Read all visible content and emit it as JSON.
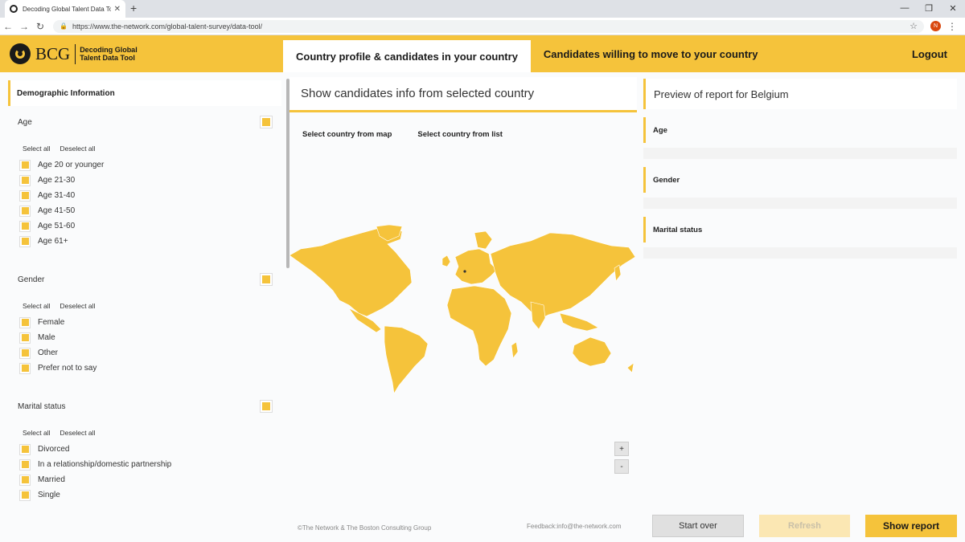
{
  "browser": {
    "tab_title": "Decoding Global Talent Data Too",
    "url": "https://www.the-network.com/global-talent-survey/data-tool/",
    "profile_initial": "N"
  },
  "header": {
    "logo_text": "BCG",
    "logo_subtitle_1": "Decoding Global",
    "logo_subtitle_2": "Talent Data Tool",
    "tabs": [
      {
        "label": "Country profile & candidates in your country"
      },
      {
        "label": "Candidates willing to move to your country"
      }
    ],
    "logout": "Logout"
  },
  "sidebar": {
    "section_title": "Demographic Information",
    "select_all": "Select all",
    "deselect_all": "Deselect all",
    "groups": [
      {
        "title": "Age",
        "options": [
          "Age 20 or younger",
          "Age 21-30",
          "Age 31-40",
          "Age 41-50",
          "Age 51-60",
          "Age 61+"
        ]
      },
      {
        "title": "Gender",
        "options": [
          "Female",
          "Male",
          "Other",
          "Prefer not to say"
        ]
      },
      {
        "title": "Marital status",
        "options": [
          "Divorced",
          "In a relationship/domestic partnership",
          "Married",
          "Single"
        ]
      }
    ]
  },
  "center": {
    "title": "Show candidates info from selected country",
    "select_map": "Select country from map",
    "select_list": "Select country from list",
    "zoom_in": "+",
    "zoom_out": "-",
    "map_color": "#f5c33b"
  },
  "right": {
    "preview_title": "Preview of report for Belgium",
    "sections": [
      "Age",
      "Gender",
      "Marital status"
    ]
  },
  "footer": {
    "copyright": "©The Network & The Boston Consulting Group",
    "feedback": "Feedback:info@the-network.com"
  },
  "buttons": {
    "start_over": "Start over",
    "refresh": "Refresh",
    "show_report": "Show report"
  },
  "colors": {
    "accent": "#f5c33b"
  }
}
